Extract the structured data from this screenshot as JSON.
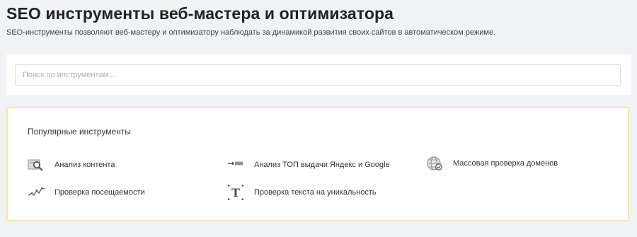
{
  "header": {
    "title": "SEO инструменты веб-мастера и оптимизатора",
    "subtitle": "SEO-инструменты позволяют веб-мастеру и оптимизатору наблюдать за динамикой развития своих сайтов в автоматическом режиме."
  },
  "search": {
    "placeholder": "Поиск по инструментам...",
    "value": ""
  },
  "popular": {
    "heading": "Популярные инструменты",
    "tools": [
      {
        "label": "Анализ контента",
        "icon": "magnifier-window-icon"
      },
      {
        "label": "Анализ ТОП выдачи Яндекс и Google",
        "icon": "arrow-bar-icon"
      },
      {
        "label": "Массовая проверка доменов",
        "icon": "globe-check-icon"
      },
      {
        "label": "Проверка посещаемости",
        "icon": "traffic-graph-icon"
      },
      {
        "label": "Проверка текста на уникальность",
        "icon": "text-t-icon"
      }
    ]
  },
  "colors": {
    "background": "#f1f2f5",
    "card_border": "#fbe7a8",
    "icon_gray": "#5a5f66"
  }
}
